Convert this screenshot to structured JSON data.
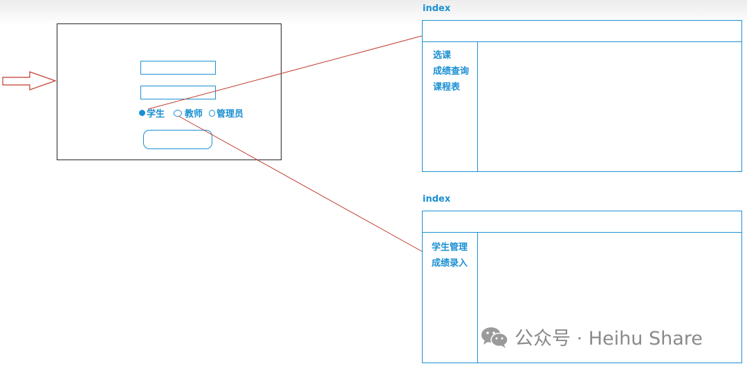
{
  "login": {
    "roles": [
      {
        "label": "学生",
        "checked": true
      },
      {
        "label": "教师",
        "checked": false
      },
      {
        "label": "管理员",
        "checked": false
      }
    ]
  },
  "student_page": {
    "title": "index",
    "menu": [
      "选课",
      "成绩查询",
      "课程表"
    ]
  },
  "teacher_page": {
    "title": "index",
    "menu": [
      "学生管理",
      "成绩录入"
    ]
  },
  "watermark": {
    "text": "公众号 · Heihu Share",
    "icon": "wechat-icon"
  },
  "colors": {
    "accent": "#1a8fd2",
    "connector": "#c0392b",
    "frame": "#222222",
    "watermark": "#8a8a8a"
  }
}
